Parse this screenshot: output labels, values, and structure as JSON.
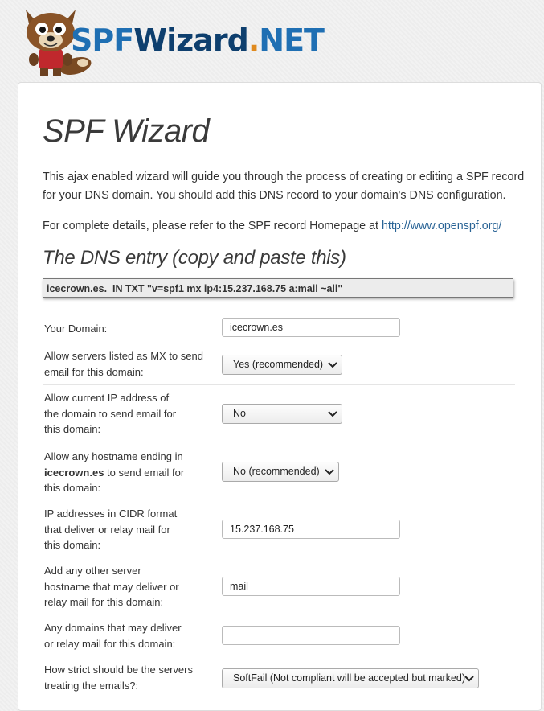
{
  "logo": {
    "part_spf": "SPF",
    "part_wizard": "Wizard",
    "part_dot": ".",
    "part_net": "NET"
  },
  "page": {
    "title": "SPF Wizard",
    "intro": "This ajax enabled wizard will guide you through the process of creating or editing a SPF record for your DNS domain. You should add this DNS record to your domain's DNS configuration.",
    "details_prefix": "For complete details, please refer to the SPF record Homepage at ",
    "details_link": "http://www.openspf.org/",
    "dns_heading": "The DNS entry (copy and paste this)",
    "dns_record": "icecrown.es.  IN TXT \"v=spf1 mx ip4:15.237.168.75 a:mail ~all\""
  },
  "form": {
    "domain": {
      "label": "Your Domain:",
      "value": "icecrown.es"
    },
    "mx": {
      "label": "Allow servers listed as MX to send email for this domain:",
      "selected": "Yes (recommended)"
    },
    "a": {
      "label": "Allow current IP address of the domain to send email for this domain:",
      "selected": "No"
    },
    "ptr": {
      "label_prefix": "Allow any hostname ending in ",
      "label_domain": "icecrown.es",
      "label_suffix": " to send email for this domain:",
      "selected": "No (recommended)"
    },
    "ip4": {
      "label": "IP addresses in CIDR format that deliver or relay mail for this domain:",
      "value": "15.237.168.75"
    },
    "a_hosts": {
      "label": "Add any other server hostname that may deliver or relay mail for this domain:",
      "value": "mail"
    },
    "include": {
      "label": "Any domains that may deliver or relay mail for this domain:",
      "value": ""
    },
    "all": {
      "label": "How strict should be the servers treating the emails?:",
      "selected": "SoftFail (Not compliant will be accepted but marked)"
    }
  },
  "colors": {
    "accent": "#1f6fb3",
    "link": "#2a6496",
    "logo_dot": "#e08a1e"
  },
  "icons": {
    "mascot": "wolf-mascot-icon",
    "dropdown": "chevron-down-icon"
  }
}
